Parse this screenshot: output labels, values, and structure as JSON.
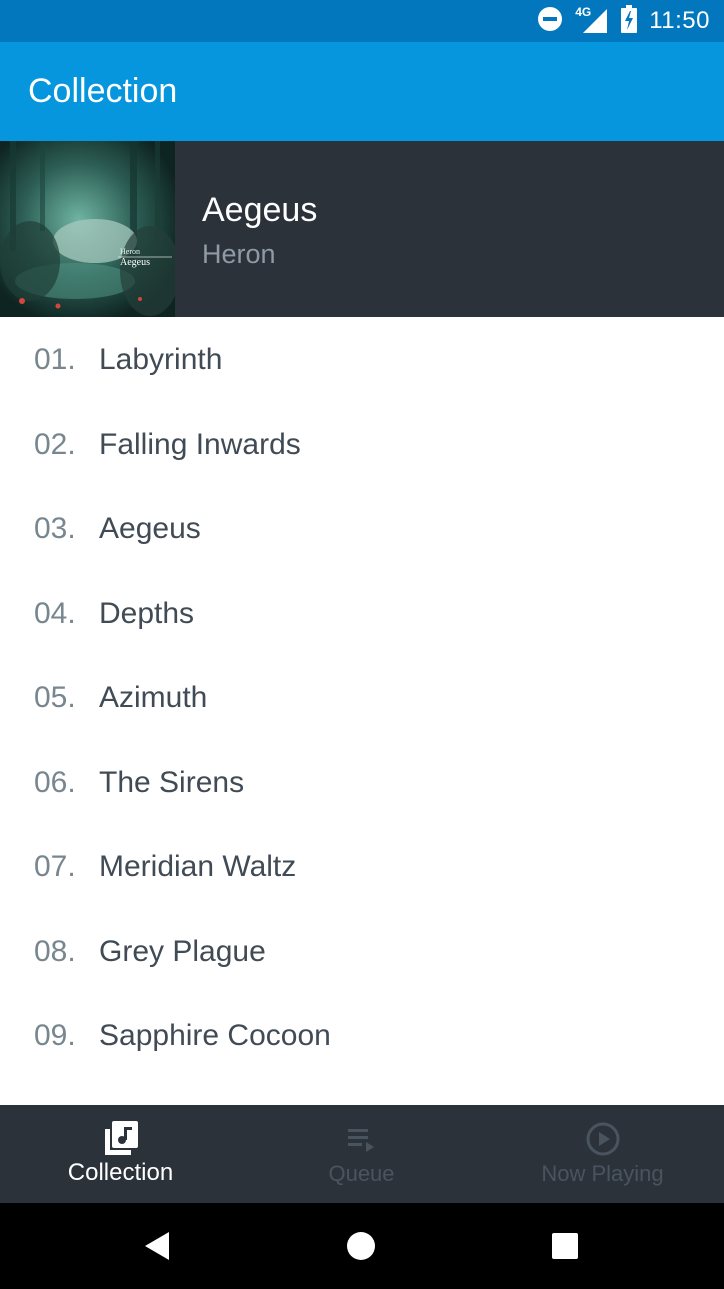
{
  "status_bar": {
    "time": "11:50",
    "network_label": "4G",
    "icons": [
      "do-not-disturb-icon",
      "cellular-signal-icon",
      "battery-charging-icon"
    ]
  },
  "app_bar": {
    "title": "Collection"
  },
  "album": {
    "title": "Aegeus",
    "artist": "Heron",
    "cover_artist": "Heron",
    "cover_title": "Aegeus"
  },
  "tracks": [
    {
      "number": "01.",
      "title": "Labyrinth"
    },
    {
      "number": "02.",
      "title": "Falling Inwards"
    },
    {
      "number": "03.",
      "title": "Aegeus"
    },
    {
      "number": "04.",
      "title": "Depths"
    },
    {
      "number": "05.",
      "title": "Azimuth"
    },
    {
      "number": "06.",
      "title": "The Sirens"
    },
    {
      "number": "07.",
      "title": "Meridian Waltz"
    },
    {
      "number": "08.",
      "title": "Grey Plague"
    },
    {
      "number": "09.",
      "title": "Sapphire Cocoon"
    }
  ],
  "bottom_nav": {
    "items": [
      {
        "label": "Collection",
        "icon": "library-music-icon",
        "active": true
      },
      {
        "label": "Queue",
        "icon": "queue-icon",
        "active": false
      },
      {
        "label": "Now Playing",
        "icon": "play-circle-icon",
        "active": false
      }
    ]
  },
  "system_nav": {
    "icons": [
      "back-icon",
      "home-icon",
      "recents-icon"
    ]
  },
  "colors": {
    "status_bar": "#0277bd",
    "app_bar": "#0596dd",
    "dark_surface": "#2b323a",
    "track_text": "#414b55",
    "track_number": "#78868f",
    "inactive_nav": "#4a545e"
  }
}
